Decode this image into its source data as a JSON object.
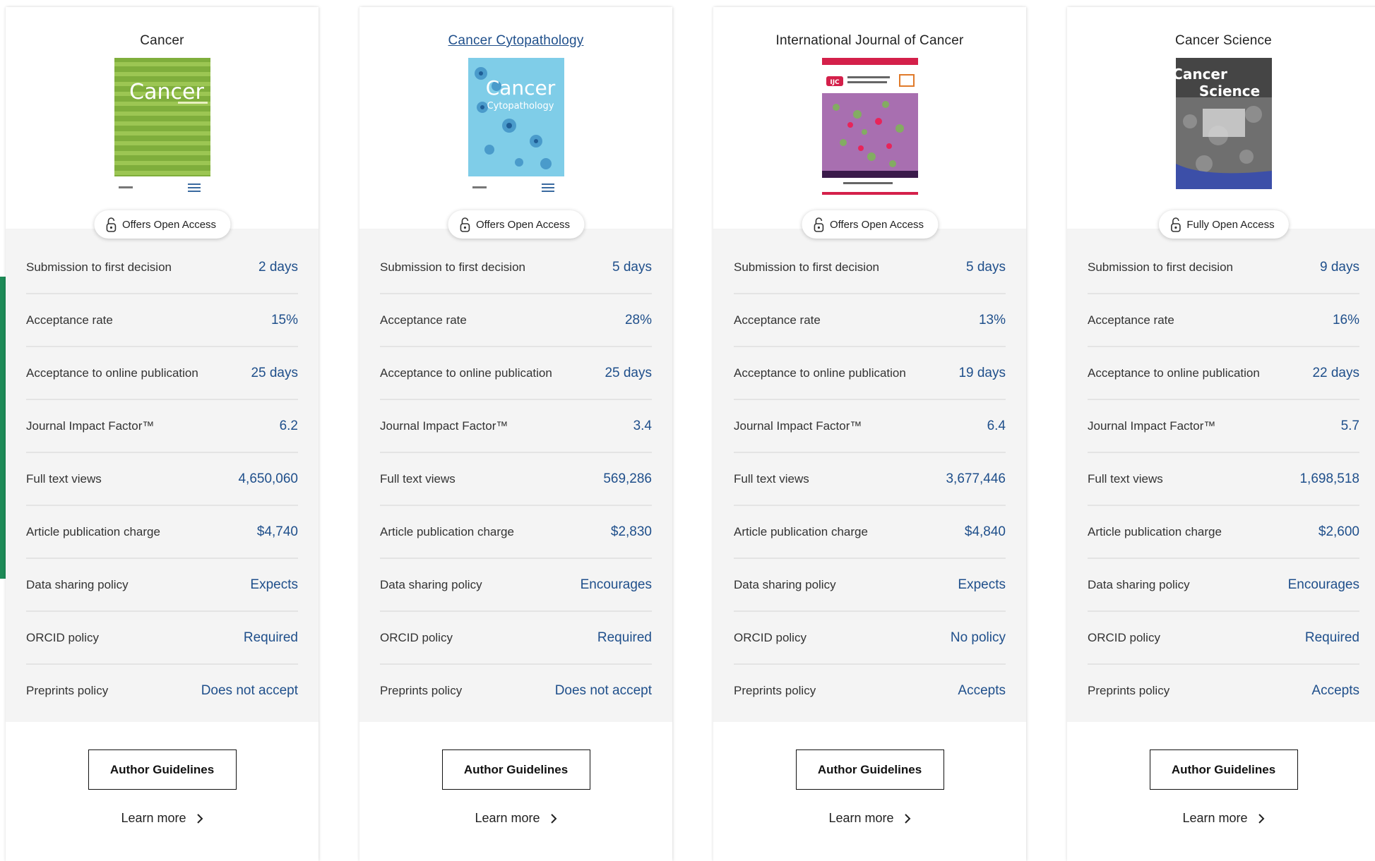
{
  "ui": {
    "author_guidelines_label": "Author Guidelines",
    "learn_more_label": "Learn more"
  },
  "colors": {
    "accent_blue": "#1f4f8b",
    "side_tab_green": "#1d8a57",
    "metrics_bg": "#f4f4f4"
  },
  "journals": [
    {
      "title": "Cancer",
      "cover_text": "Cancer",
      "access": "Offers Open Access",
      "metrics": [
        {
          "label": "Submission to first decision",
          "value": "2 days"
        },
        {
          "label": "Acceptance rate",
          "value": "15%"
        },
        {
          "label": "Acceptance to online publication",
          "value": "25 days"
        },
        {
          "label": "Journal Impact Factor™",
          "value": "6.2"
        },
        {
          "label": "Full text views",
          "value": "4,650,060"
        },
        {
          "label": "Article publication charge",
          "value": "$4,740"
        },
        {
          "label": "Data sharing policy",
          "value": "Expects"
        },
        {
          "label": "ORCID policy",
          "value": "Required"
        },
        {
          "label": "Preprints policy",
          "value": "Does not accept"
        }
      ]
    },
    {
      "title": "Cancer Cytopathology",
      "cover_text": "Cancer",
      "cover_subtext": "Cytopathology",
      "access": "Offers Open Access",
      "metrics": [
        {
          "label": "Submission to first decision",
          "value": "5 days"
        },
        {
          "label": "Acceptance rate",
          "value": "28%"
        },
        {
          "label": "Acceptance to online publication",
          "value": "25 days"
        },
        {
          "label": "Journal Impact Factor™",
          "value": "3.4"
        },
        {
          "label": "Full text views",
          "value": "569,286"
        },
        {
          "label": "Article publication charge",
          "value": "$2,830"
        },
        {
          "label": "Data sharing policy",
          "value": "Encourages"
        },
        {
          "label": "ORCID policy",
          "value": "Required"
        },
        {
          "label": "Preprints policy",
          "value": "Does not accept"
        }
      ]
    },
    {
      "title": "International Journal of Cancer",
      "cover_text": "IJC",
      "access": "Offers Open Access",
      "metrics": [
        {
          "label": "Submission to first decision",
          "value": "5 days"
        },
        {
          "label": "Acceptance rate",
          "value": "13%"
        },
        {
          "label": "Acceptance to online publication",
          "value": "19 days"
        },
        {
          "label": "Journal Impact Factor™",
          "value": "6.4"
        },
        {
          "label": "Full text views",
          "value": "3,677,446"
        },
        {
          "label": "Article publication charge",
          "value": "$4,840"
        },
        {
          "label": "Data sharing policy",
          "value": "Expects"
        },
        {
          "label": "ORCID policy",
          "value": "No policy"
        },
        {
          "label": "Preprints policy",
          "value": "Accepts"
        }
      ]
    },
    {
      "title": "Cancer Science",
      "cover_text": "Cancer",
      "cover_subtext": "Science",
      "access": "Fully Open Access",
      "metrics": [
        {
          "label": "Submission to first decision",
          "value": "9 days"
        },
        {
          "label": "Acceptance rate",
          "value": "16%"
        },
        {
          "label": "Acceptance to online publication",
          "value": "22 days"
        },
        {
          "label": "Journal Impact Factor™",
          "value": "5.7"
        },
        {
          "label": "Full text views",
          "value": "1,698,518"
        },
        {
          "label": "Article publication charge",
          "value": "$2,600"
        },
        {
          "label": "Data sharing policy",
          "value": "Encourages"
        },
        {
          "label": "ORCID policy",
          "value": "Required"
        },
        {
          "label": "Preprints policy",
          "value": "Accepts"
        }
      ]
    }
  ]
}
